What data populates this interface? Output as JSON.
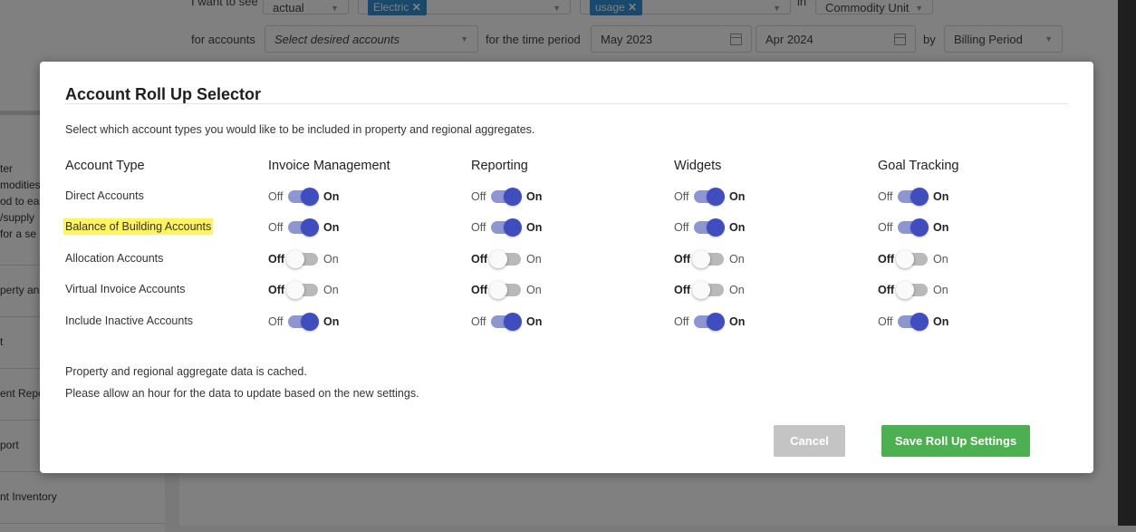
{
  "background": {
    "filter_row1": {
      "want_label": "I want to see",
      "want_value": "actual",
      "commodity_tag": "Electric",
      "metric_tag": "usage",
      "in_label": "in",
      "unit_value": "Commodity Unit"
    },
    "filter_row2": {
      "accounts_label": "for accounts",
      "accounts_placeholder": "Select desired accounts",
      "period_label": "for the time period",
      "start_date": "May 2023",
      "end_date": "Apr 2024",
      "by_label": "by",
      "by_value": "Billing Period"
    },
    "side_items": [
      {
        "lines": [
          "ter",
          "modities",
          "od to ea",
          "/supply",
          "for a se"
        ]
      },
      {
        "lines": [
          "perty an"
        ]
      },
      {
        "lines": [
          "t"
        ]
      },
      {
        "lines": [
          "ent Repo"
        ]
      },
      {
        "lines": [
          "port"
        ]
      },
      {
        "lines": [
          "nt Inventory"
        ]
      }
    ]
  },
  "modal": {
    "title": "Account Roll Up Selector",
    "description": "Select which account types you would like to be included in property and regional aggregates.",
    "column_headers": [
      "Account Type",
      "Invoice Management",
      "Reporting",
      "Widgets",
      "Goal Tracking"
    ],
    "off_label": "Off",
    "on_label": "On",
    "rows": [
      {
        "label": "Direct Accounts",
        "highlight": false,
        "states": [
          true,
          true,
          true,
          true
        ]
      },
      {
        "label": "Balance of Building Accounts",
        "highlight": true,
        "states": [
          true,
          true,
          true,
          true
        ]
      },
      {
        "label": "Allocation Accounts",
        "highlight": false,
        "states": [
          false,
          false,
          false,
          false
        ]
      },
      {
        "label": "Virtual Invoice Accounts",
        "highlight": false,
        "states": [
          false,
          false,
          false,
          false
        ]
      },
      {
        "label": "Include Inactive Accounts",
        "highlight": false,
        "states": [
          true,
          true,
          true,
          true
        ]
      }
    ],
    "footer_line1": "Property and regional aggregate data is cached.",
    "footer_line2": "Please allow an hour for the data to update based on the new settings.",
    "cancel_label": "Cancel",
    "save_label": "Save Roll Up Settings"
  },
  "colors": {
    "toggle_on_knob": "#3f4dbf",
    "toggle_on_track": "#8d96cf",
    "save_button": "#4caf50",
    "cancel_button": "#c4c4c4",
    "highlight": "#fff45a"
  }
}
